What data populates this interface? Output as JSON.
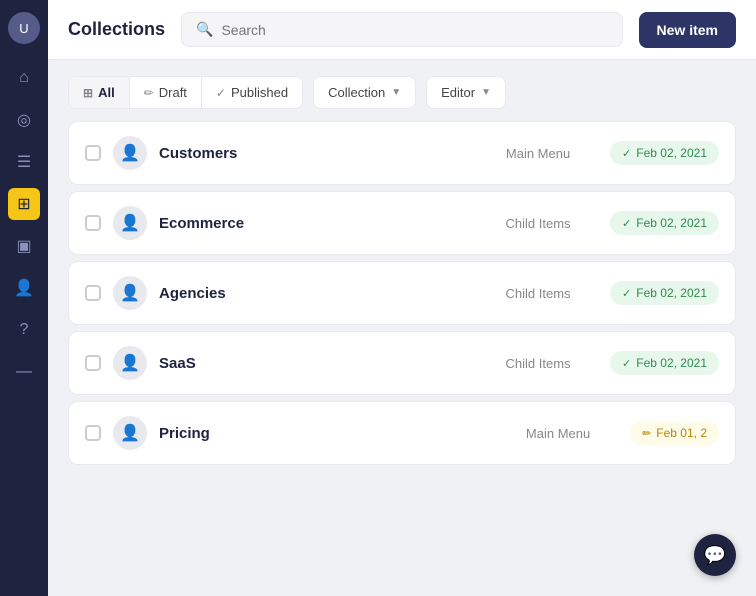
{
  "sidebar": {
    "avatar_label": "U",
    "icons": [
      {
        "name": "home-icon",
        "symbol": "⌂",
        "active": false
      },
      {
        "name": "bookmark-icon",
        "symbol": "◎",
        "active": false
      },
      {
        "name": "document-icon",
        "symbol": "☰",
        "active": false
      },
      {
        "name": "grid-icon",
        "symbol": "⊞",
        "active": true
      },
      {
        "name": "image-icon",
        "symbol": "▣",
        "active": false
      },
      {
        "name": "users-icon",
        "symbol": "👤",
        "active": false
      },
      {
        "name": "help-icon",
        "symbol": "?",
        "active": false
      },
      {
        "name": "minus-icon",
        "symbol": "—",
        "active": false
      }
    ]
  },
  "header": {
    "title": "Collections",
    "search_placeholder": "Search",
    "new_item_label": "New item"
  },
  "filters": {
    "all_label": "All",
    "draft_label": "Draft",
    "published_label": "Published",
    "collection_label": "Collection",
    "editor_label": "Editor"
  },
  "collections": [
    {
      "name": "Customers",
      "tag": "Main Menu",
      "date": "Feb 02, 2021",
      "status": "published"
    },
    {
      "name": "Ecommerce",
      "tag": "Child Items",
      "date": "Feb 02, 2021",
      "status": "published"
    },
    {
      "name": "Agencies",
      "tag": "Child Items",
      "date": "Feb 02, 2021",
      "status": "published"
    },
    {
      "name": "SaaS",
      "tag": "Child Items",
      "date": "Feb 02, 2021",
      "status": "published"
    },
    {
      "name": "Pricing",
      "tag": "Main Menu",
      "date": "Feb 01, 2",
      "status": "edit"
    }
  ],
  "chat_icon": "💬",
  "colors": {
    "sidebar_bg": "#1e2340",
    "active_icon_bg": "#f5c518",
    "new_btn_bg": "#2d3566",
    "published_bg": "#e8f7ec",
    "published_color": "#2d8c4e",
    "edit_bg": "#fefbe8",
    "edit_color": "#b5860a"
  }
}
